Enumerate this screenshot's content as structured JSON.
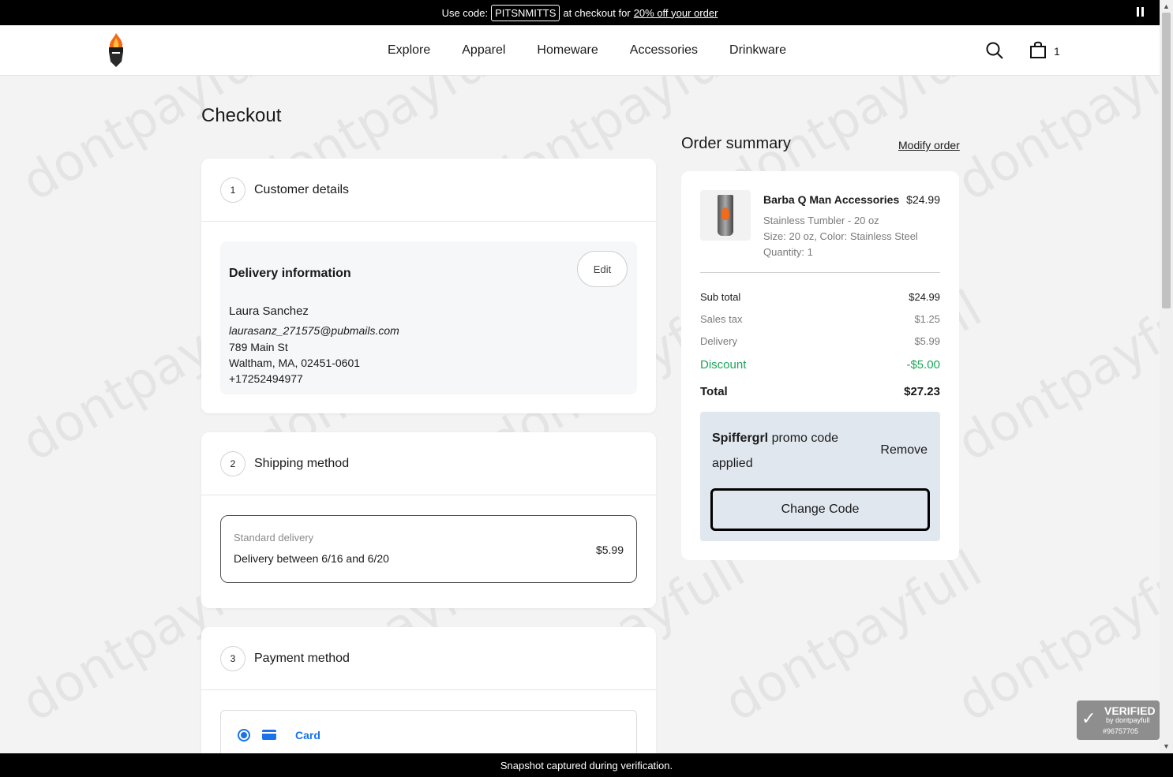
{
  "promo_bar": {
    "prefix": "Use code:",
    "code": "PITSNMITTS",
    "middle": "at checkout for",
    "link": "20% off your order"
  },
  "nav": {
    "items": [
      "Explore",
      "Apparel",
      "Homeware",
      "Accessories",
      "Drinkware"
    ],
    "cart_count": "1"
  },
  "page_title": "Checkout",
  "customer": {
    "step": "1",
    "title": "Customer details",
    "delivery_heading": "Delivery information",
    "edit_label": "Edit",
    "name": "Laura Sanchez",
    "email": "laurasanz_271575@pubmails.com",
    "street": "789 Main St",
    "city_line": "Waltham, MA, 02451-0601",
    "phone": "+17252494977"
  },
  "shipping": {
    "step": "2",
    "title": "Shipping method",
    "option_label": "Standard delivery",
    "option_dates": "Delivery between 6/16 and 6/20",
    "option_price": "$5.99"
  },
  "payment": {
    "step": "3",
    "title": "Payment method",
    "option_label": "Card"
  },
  "summary": {
    "title": "Order summary",
    "modify_label": "Modify order",
    "product": {
      "name": "Barba Q Man Accessories",
      "price": "$24.99",
      "variant": "Stainless Tumbler - 20 oz",
      "options": "Size: 20 oz, Color: Stainless Steel",
      "quantity": "Quantity: 1"
    },
    "lines": {
      "subtotal_label": "Sub total",
      "subtotal_value": "$24.99",
      "tax_label": "Sales tax",
      "tax_value": "$1.25",
      "delivery_label": "Delivery",
      "delivery_value": "$5.99",
      "discount_label": "Discount",
      "discount_value": "-$5.00",
      "total_label": "Total",
      "total_value": "$27.23"
    },
    "promo": {
      "code": "Spiffergrl",
      "suffix": "promo code applied",
      "remove_label": "Remove",
      "change_label": "Change Code"
    }
  },
  "watermark_text": "dontpayfull",
  "verified": {
    "title": "VERIFIED",
    "by": "by dontpayfull",
    "number": "#96757705"
  },
  "footer_text": "Snapshot captured during verification.",
  "colors": {
    "accent_blue": "#1a73e8",
    "discount_green": "#1ba659",
    "promo_bg": "#e1e7ef"
  }
}
